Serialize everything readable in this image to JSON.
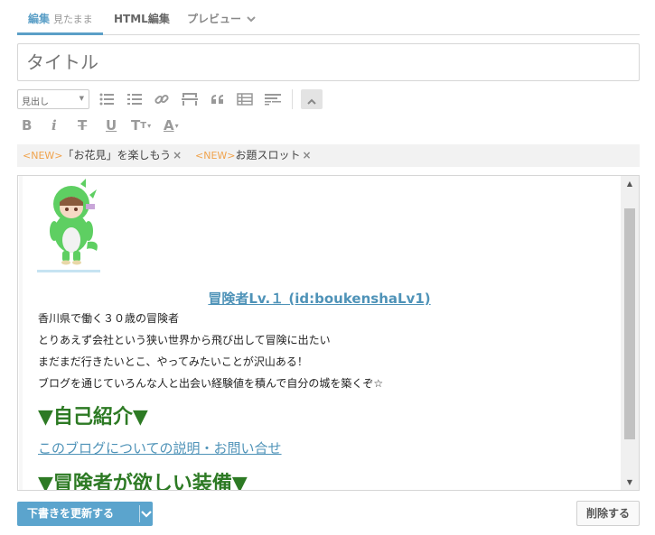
{
  "tabs": {
    "edit_label": "編集",
    "edit_sub": "見たまま",
    "html_label": "HTML編集",
    "preview_label": "プレビュー"
  },
  "title_input": {
    "placeholder": "タイトル"
  },
  "toolbar": {
    "heading_select": "見出し",
    "icons": [
      "list-ul-icon",
      "list-ol-icon",
      "link-icon",
      "horizontal-rule-icon",
      "quote-icon",
      "table-icon",
      "read-more-icon",
      "collapse-icon"
    ],
    "format_labels": {
      "bold": "B",
      "italic": "i",
      "strike": "T",
      "underline": "U",
      "font_size": "T",
      "font_color": "A"
    }
  },
  "tags": [
    {
      "badge": "<NEW>",
      "text": "「お花見」を楽しもう",
      "close": "×"
    },
    {
      "badge": "<NEW>",
      "text": "お題スロット",
      "close": "×"
    }
  ],
  "editor": {
    "profile_link": "冒険者Lv.１ (id:boukenshaLv1)",
    "lines": [
      "香川県で働く３０歳の冒険者",
      "とりあえず会社という狭い世界から飛び出して冒険に出たい",
      "まだまだ行きたいとこ、やってみたいことが沢山ある！",
      "ブログを通じていろんな人と出会い経験値を積んで自分の城を築くぞ☆"
    ],
    "heading_intro": "▼自己紹介▼",
    "blog_link": "このブログについての説明・お問い合せ",
    "heading_equipment": "▼冒険者が欲しい装備▼"
  },
  "buttons": {
    "save": "下書きを更新する",
    "delete": "削除する"
  },
  "colors": {
    "accent": "#5ba4cd",
    "link": "#4f93b8",
    "heading_green": "#2d7a24",
    "tag_new": "#f0a34d"
  }
}
